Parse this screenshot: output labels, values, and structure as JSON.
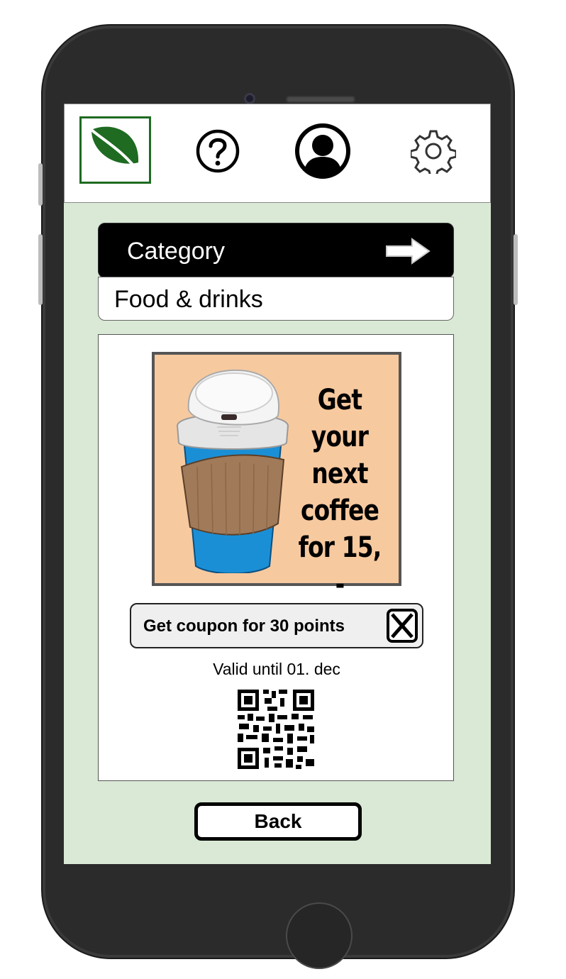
{
  "header": {
    "logo_icon": "leaf-icon",
    "help_icon": "question-mark-icon",
    "profile_icon": "user-icon",
    "settings_icon": "gear-icon"
  },
  "category": {
    "label": "Category",
    "arrow_icon": "arrow-right-icon",
    "selected": "Food & drinks"
  },
  "offer": {
    "promo_lines": [
      "Get your",
      "next",
      "coffee",
      "for 15, -"
    ],
    "coupon_label": "Get coupon for 30 points",
    "coupon_icon": "close-icon",
    "valid_until": "Valid until 01. dec"
  },
  "footer": {
    "back_label": "Back"
  },
  "colors": {
    "screen_bg": "#d9e9d5",
    "logo_green": "#1e6b21",
    "promo_bg": "#f7c99f",
    "cup_blue": "#1b8fd6",
    "sleeve_brown": "#a17a5a"
  }
}
